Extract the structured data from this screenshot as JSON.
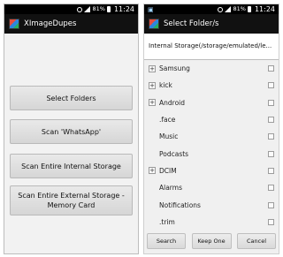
{
  "left": {
    "status": {
      "battery": "81%",
      "time": "11:24"
    },
    "title": "XImageDupes",
    "buttons": [
      {
        "label": "Select Folders"
      },
      {
        "label": "Scan 'WhatsApp'"
      },
      {
        "label": "Scan Entire Internal Storage"
      },
      {
        "label": "Scan Entire External Storage - Memory Card"
      }
    ]
  },
  "right": {
    "status": {
      "battery": "81%",
      "time": "11:24"
    },
    "title": "Select Folder/s",
    "path": "Internal Storage(/storage/emulated/le...",
    "folders": [
      {
        "name": "Samsung",
        "expandable": true,
        "expand_symbol": "+"
      },
      {
        "name": "kick",
        "expandable": true,
        "expand_symbol": "+"
      },
      {
        "name": "Android",
        "expandable": true,
        "expand_symbol": "+"
      },
      {
        "name": ".face",
        "expandable": false,
        "expand_symbol": ""
      },
      {
        "name": "Music",
        "expandable": false,
        "expand_symbol": ""
      },
      {
        "name": "Podcasts",
        "expandable": false,
        "expand_symbol": ""
      },
      {
        "name": "DCIM",
        "expandable": true,
        "expand_symbol": "+"
      },
      {
        "name": "Alarms",
        "expandable": false,
        "expand_symbol": ""
      },
      {
        "name": "Notifications",
        "expandable": false,
        "expand_symbol": ""
      },
      {
        "name": ".trim",
        "expandable": false,
        "expand_symbol": ""
      }
    ],
    "bottom_buttons": {
      "search": "Search",
      "keep_one": "Keep One",
      "cancel": "Cancel"
    }
  }
}
